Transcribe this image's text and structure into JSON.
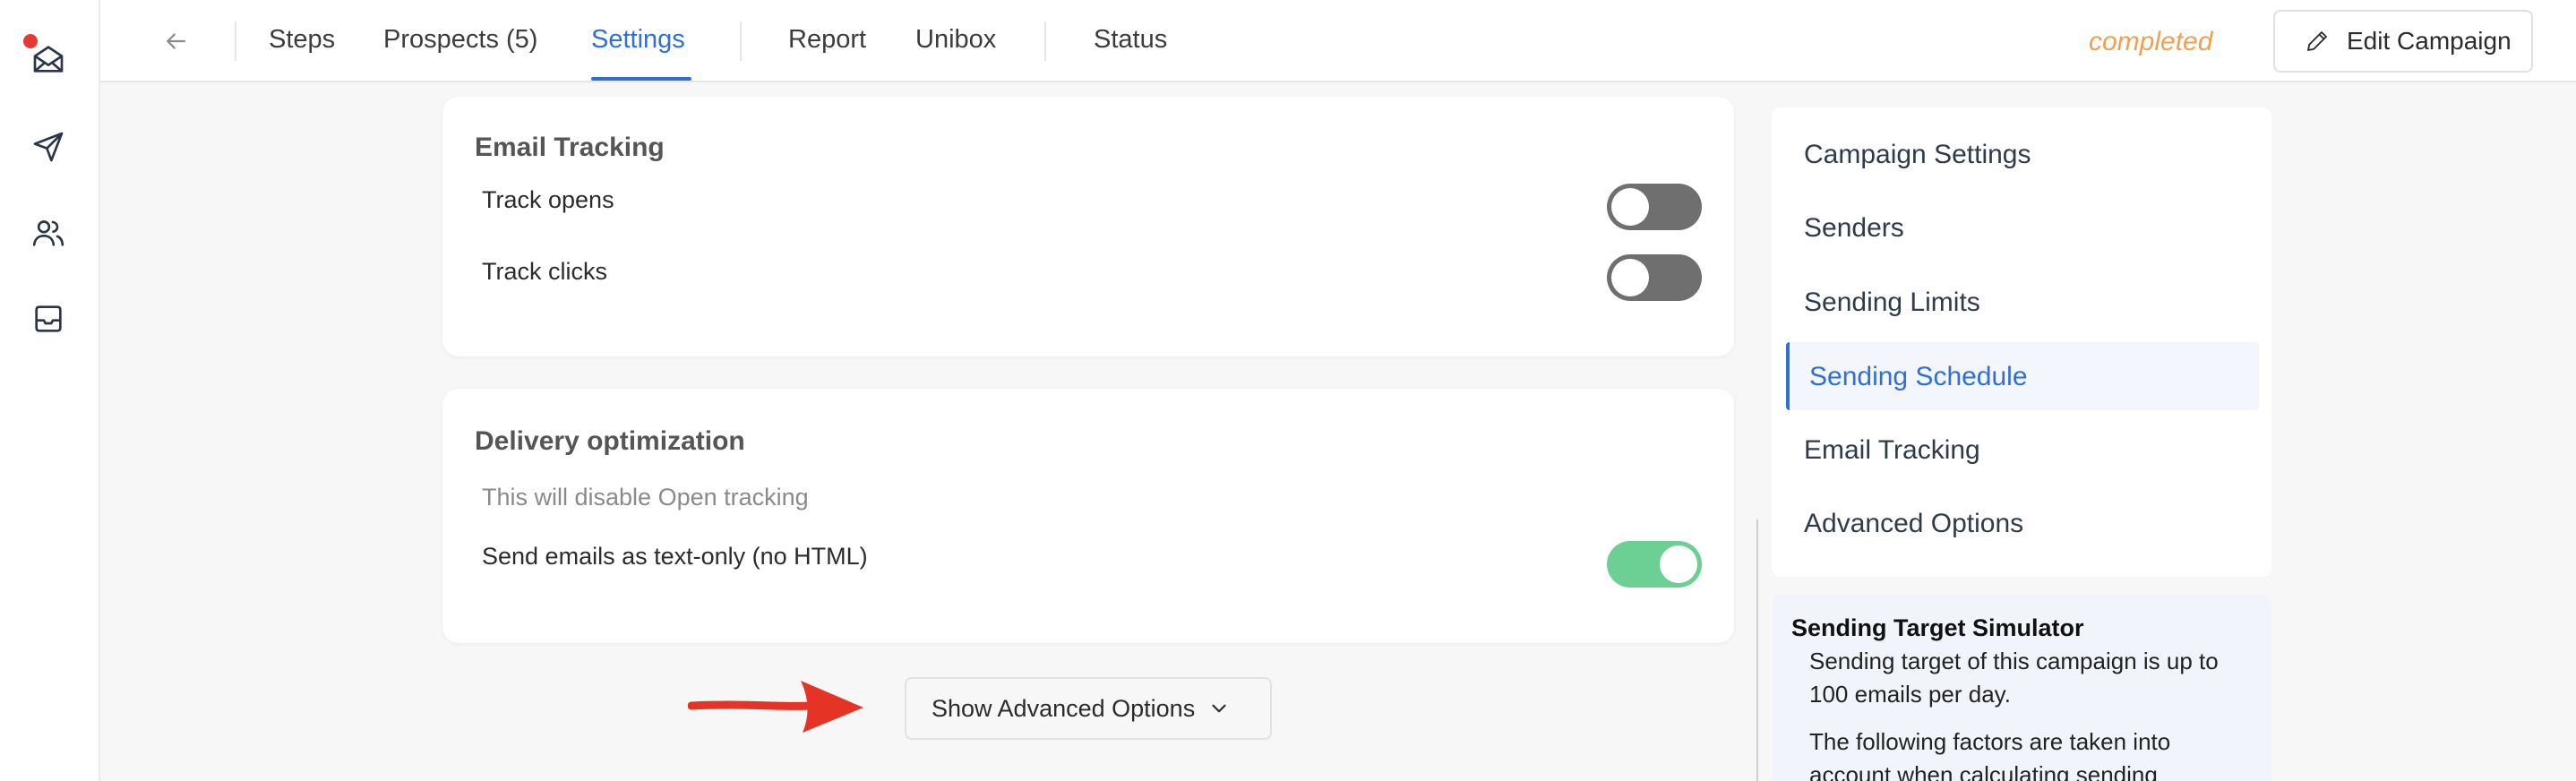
{
  "rail": {
    "items": [
      {
        "icon": "mail-open-icon"
      },
      {
        "icon": "send-icon"
      },
      {
        "icon": "users-icon"
      },
      {
        "icon": "inbox-icon"
      }
    ],
    "notification_color": "#e53935"
  },
  "topbar": {
    "tabs": [
      "Steps",
      "Prospects (5)",
      "Settings",
      "Report",
      "Unibox",
      "Status"
    ],
    "active_tab": "Settings",
    "status": "completed",
    "edit_label": "Edit Campaign"
  },
  "email_tracking": {
    "title": "Email Tracking",
    "rows": [
      {
        "label": "Track opens",
        "enabled": false
      },
      {
        "label": "Track clicks",
        "enabled": false
      }
    ]
  },
  "delivery": {
    "title": "Delivery optimization",
    "hint": "This will disable Open tracking",
    "row": {
      "label": "Send emails as text-only (no HTML)",
      "enabled": true
    }
  },
  "advanced_button": {
    "label": "Show Advanced Options"
  },
  "side_nav": {
    "items": [
      "Campaign Settings",
      "Senders",
      "Sending Limits",
      "Sending Schedule",
      "Email Tracking",
      "Advanced Options"
    ],
    "active": "Sending Schedule"
  },
  "simulator": {
    "title": "Sending Target Simulator",
    "target_text": "Sending target of this campaign is up to 100 emails per day.",
    "factors_text": "The following factors are taken into account when calculating sending"
  },
  "colors": {
    "accent": "#2f6fd6",
    "status": "#f0a050",
    "toggle_on": "#6ccf94",
    "toggle_off": "#6f6f6f",
    "annotation_arrow": "#e53325"
  }
}
